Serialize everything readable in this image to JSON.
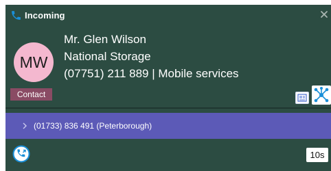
{
  "title_bar": {
    "icon": "phone-icon",
    "title": "Incoming",
    "close_icon": "close-icon"
  },
  "caller": {
    "initials": "MW",
    "name": "Mr. Glen Wilson",
    "company": "National Storage",
    "phone": "(07751) 211 889 | Mobile services",
    "badge": "Contact"
  },
  "actions": {
    "card_icon": "contact-card-icon",
    "network_icon": "network-icon"
  },
  "line": {
    "chevron_icon": "chevron-right-icon",
    "text": "(01733) 836 491 (Peterborough)"
  },
  "footer": {
    "call_icon": "call-icon",
    "timer": "10s"
  },
  "colors": {
    "background": "#2c4c42",
    "line_bar": "#5c5ab7",
    "avatar": "#f4b8cf",
    "badge": "#8a4b64",
    "accent_blue": "#1a8fd8"
  }
}
